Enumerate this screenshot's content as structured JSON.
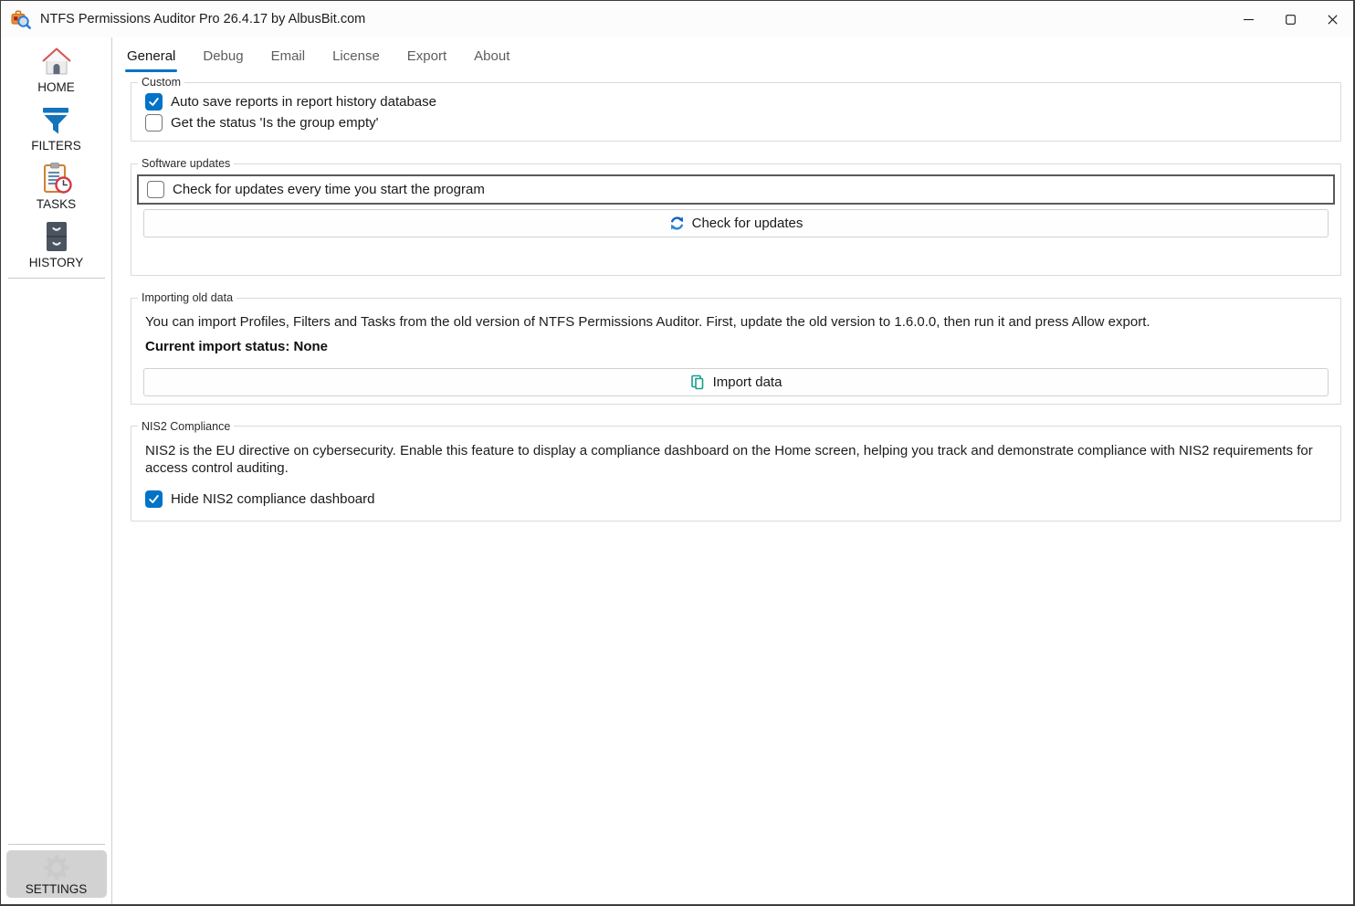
{
  "window": {
    "title": "NTFS Permissions Auditor Pro 26.4.17 by AlbusBit.com",
    "controls": {
      "minimize": "minimize",
      "maximize": "maximize",
      "close": "close"
    }
  },
  "colors": {
    "accent_blue": "#0173c7",
    "focus_border": "#5a5a5a",
    "group_border": "#dadada",
    "refresh_icon_blue": "#1565c0",
    "import_icon_teal": "#16a08c",
    "settings_bg": "#d2d2d2"
  },
  "sidebar": {
    "items": [
      {
        "label": "HOME",
        "icon": "home-icon"
      },
      {
        "label": "FILTERS",
        "icon": "filter-icon"
      },
      {
        "label": "TASKS",
        "icon": "clipboard-clock-icon"
      },
      {
        "label": "HISTORY",
        "icon": "file-cabinet-icon"
      }
    ],
    "settings": {
      "label": "SETTINGS",
      "icon": "gear-icon"
    }
  },
  "tabs": [
    {
      "label": "General",
      "active": true
    },
    {
      "label": "Debug",
      "active": false
    },
    {
      "label": "Email",
      "active": false
    },
    {
      "label": "License",
      "active": false
    },
    {
      "label": "Export",
      "active": false
    },
    {
      "label": "About",
      "active": false
    }
  ],
  "general": {
    "custom": {
      "legend": "Custom",
      "checkboxes": [
        {
          "label": "Auto save reports in report history database",
          "checked": true
        },
        {
          "label": "Get the status 'Is the group empty'",
          "checked": false
        }
      ]
    },
    "software_updates": {
      "legend": "Software updates",
      "checkbox": {
        "label": "Check for updates every time you start the program",
        "checked": false
      },
      "button_label": "Check for updates",
      "button_icon": "refresh-icon"
    },
    "importing": {
      "legend": "Importing old data",
      "description": "You can import Profiles, Filters and Tasks from the old version of NTFS Permissions Auditor. First, update the old version to 1.6.0.0, then run it and press Allow export.",
      "status_line": "Current import status: None",
      "button_label": "Import data",
      "button_icon": "import-pages-icon"
    },
    "nis2": {
      "legend": "NIS2 Compliance",
      "description": "NIS2 is the EU directive on cybersecurity. Enable this feature to display a compliance dashboard on the Home screen, helping you track and demonstrate compliance with NIS2 requirements for access control auditing.",
      "checkbox": {
        "label": "Hide NIS2 compliance dashboard",
        "checked": true
      }
    }
  }
}
